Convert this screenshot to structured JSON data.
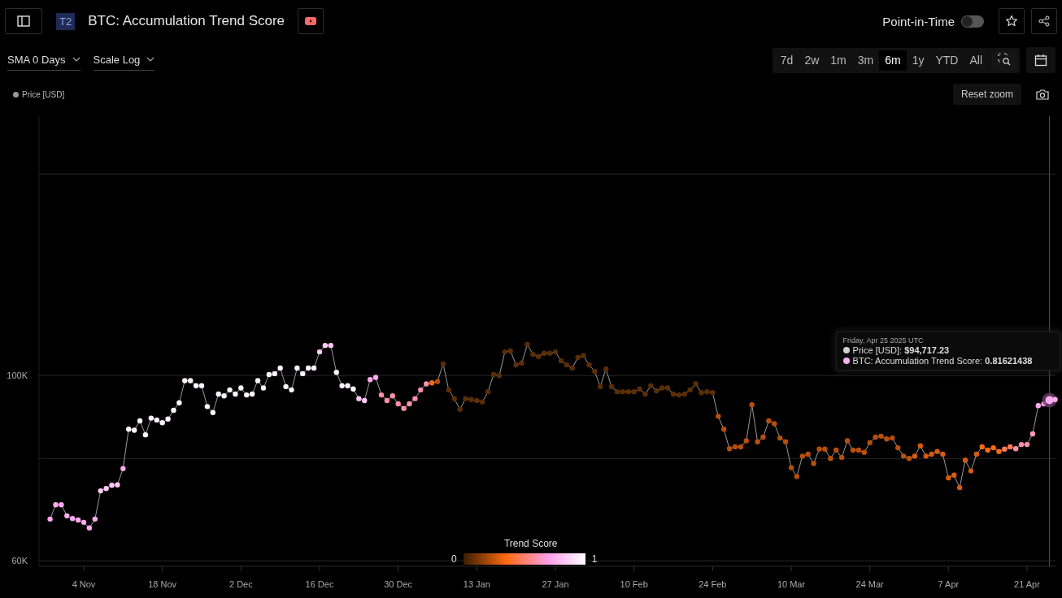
{
  "header": {
    "tier_badge": "T2",
    "title": "BTC: Accumulation Trend Score",
    "point_in_time": {
      "label": "Point-in-Time",
      "on": false
    }
  },
  "controls": {
    "sma": "SMA 0 Days",
    "scale": "Scale Log",
    "ranges": [
      {
        "label": "7d",
        "selected": false
      },
      {
        "label": "2w",
        "selected": false
      },
      {
        "label": "1m",
        "selected": false
      },
      {
        "label": "3m",
        "selected": false
      },
      {
        "label": "6m",
        "selected": true
      },
      {
        "label": "1y",
        "selected": false
      },
      {
        "label": "YTD",
        "selected": false
      },
      {
        "label": "All",
        "selected": false
      }
    ]
  },
  "chart": {
    "reset_zoom": "Reset zoom",
    "tooltip": {
      "date": "Friday, Apr 25 2025 UTC",
      "rows": [
        {
          "text": "Price [USD]: **$94,717.23**",
          "color": "#d0d0d0"
        },
        {
          "text": "BTC: Accumulation Trend Score: **0.81621438**",
          "color": "#f9b0f2"
        }
      ]
    },
    "color_scale": {
      "title": "Trend Score",
      "min_label": "0",
      "max_label": "1"
    },
    "chart_data": {
      "type": "line",
      "ylim": [
        58800,
        156000
      ],
      "categories": [
        null,
        null,
        null,
        null,
        null,
        null,
        "4 Nov",
        null,
        null,
        null,
        null,
        null,
        null,
        null,
        null,
        null,
        null,
        null,
        null,
        null,
        "18 Nov",
        null,
        null,
        null,
        null,
        null,
        null,
        null,
        null,
        null,
        null,
        null,
        null,
        null,
        "2 Dec",
        null,
        null,
        null,
        null,
        null,
        null,
        null,
        null,
        null,
        null,
        null,
        null,
        null,
        "16 Dec",
        null,
        null,
        null,
        null,
        null,
        null,
        null,
        null,
        null,
        null,
        null,
        null,
        null,
        "30 Dec",
        null,
        null,
        null,
        null,
        null,
        null,
        null,
        null,
        null,
        null,
        null,
        null,
        null,
        "13 Jan",
        null,
        null,
        null,
        null,
        null,
        null,
        null,
        null,
        null,
        null,
        null,
        null,
        null,
        "27 Jan",
        null,
        null,
        null,
        null,
        null,
        null,
        null,
        null,
        null,
        null,
        null,
        null,
        null,
        "10 Feb",
        null,
        null,
        null,
        null,
        null,
        null,
        null,
        null,
        null,
        null,
        null,
        null,
        null,
        "24 Feb",
        null,
        null,
        null,
        null,
        null,
        null,
        null,
        null,
        null,
        null,
        null,
        null,
        null,
        "10 Mar",
        null,
        null,
        null,
        null,
        null,
        null,
        null,
        null,
        null,
        null,
        null,
        null,
        null,
        "24 Mar",
        null,
        null,
        null,
        null,
        null,
        null,
        null,
        null,
        null,
        null,
        null,
        null,
        null,
        "7 Apr",
        null,
        null,
        null,
        null,
        null,
        null,
        null,
        null,
        null,
        null,
        null,
        null,
        null,
        "21 Apr",
        null,
        null,
        null,
        null,
        null
      ],
      "series": [
        {
          "name": "Price [USD]",
          "color": "#9a9a9a",
          "marker": "o",
          "values": [
            69000,
            72100,
            72100,
            69700,
            69100,
            68800,
            68300,
            67100,
            69000,
            75100,
            75600,
            76300,
            76400,
            79900,
            88400,
            88200,
            90200,
            87200,
            90800,
            90400,
            89800,
            90600,
            92500,
            94100,
            98900,
            98900,
            97800,
            97800,
            93300,
            92000,
            96000,
            95600,
            96900,
            96000,
            97300,
            95800,
            96000,
            98900,
            97300,
            100200,
            100400,
            101600,
            97600,
            96900,
            101600,
            100400,
            101600,
            101600,
            105100,
            106500,
            106500,
            100700,
            97800,
            97800,
            97100,
            95000,
            94600,
            99100,
            99600,
            95800,
            94600,
            95600,
            93900,
            92900,
            93900,
            95000,
            96900,
            98200,
            98400,
            98700,
            102500,
            96900,
            95000,
            92700,
            95000,
            94800,
            94600,
            94300,
            96500,
            100200,
            100000,
            105100,
            105300,
            102300,
            102700,
            106700,
            104600,
            104100,
            104800,
            104800,
            105100,
            103200,
            102300,
            101600,
            103900,
            104300,
            102300,
            100900,
            97600,
            101400,
            97600,
            96500,
            96500,
            96500,
            96500,
            97100,
            96000,
            97800,
            96700,
            97300,
            97300,
            96000,
            95800,
            96000,
            96900,
            98200,
            96300,
            96500,
            96300,
            91200,
            88400,
            84200,
            84600,
            84600,
            85900,
            93700,
            85700,
            86700,
            90200,
            89600,
            86500,
            85700,
            80100,
            78200,
            82600,
            83000,
            81000,
            84100,
            84100,
            82100,
            83900,
            82300,
            85900,
            83900,
            83900,
            83400,
            85500,
            86700,
            86900,
            86300,
            86500,
            84400,
            82600,
            82100,
            82600,
            84800,
            82600,
            83000,
            83600,
            83000,
            77900,
            78500,
            75800,
            81700,
            79400,
            83000,
            84600,
            83900,
            84400,
            83600,
            84100,
            84600,
            84200,
            85100,
            85100,
            87400,
            93500,
            93900,
            94700,
            94800
          ]
        }
      ],
      "yticks": [
        {
          "value": 60000,
          "label": "60K"
        },
        {
          "value": 100000,
          "label": "100K"
        }
      ]
    },
    "trend_points": [
      {
        "color": "#ffaaee",
        "selected": false
      },
      {
        "color": "#ffaaee",
        "selected": false
      },
      {
        "color": "#ffaaee",
        "selected": false
      },
      {
        "color": "#ffaaee",
        "selected": false
      },
      {
        "color": "#ffaaee",
        "selected": false
      },
      {
        "color": "#ffaaee",
        "selected": false
      },
      {
        "color": "#ffaaee",
        "selected": false
      },
      {
        "color": "#ffaaee",
        "selected": false
      },
      {
        "color": "#ffaaee",
        "selected": false
      },
      {
        "color": "#ffc8f4",
        "selected": false
      },
      {
        "color": "#ffc8f4",
        "selected": false
      },
      {
        "color": "#ffc8f4",
        "selected": false
      },
      {
        "color": "#ffc8f4",
        "selected": false
      },
      {
        "color": "#ffaaee",
        "selected": false
      },
      {
        "color": "#fff4fc",
        "selected": false
      },
      {
        "color": "#fff4fc",
        "selected": false
      },
      {
        "color": "#fff4fc",
        "selected": false
      },
      {
        "color": "#fff4fc",
        "selected": false
      },
      {
        "color": "#fff4fc",
        "selected": false
      },
      {
        "color": "#fff4fc",
        "selected": false
      },
      {
        "color": "#fff4fc",
        "selected": false
      },
      {
        "color": "#fff4fc",
        "selected": false
      },
      {
        "color": "#fff4fc",
        "selected": false
      },
      {
        "color": "#fff4fc",
        "selected": false
      },
      {
        "color": "#fff4fc",
        "selected": false
      },
      {
        "color": "#fff4fc",
        "selected": false
      },
      {
        "color": "#fff4fc",
        "selected": false
      },
      {
        "color": "#fff4fc",
        "selected": false
      },
      {
        "color": "#fff4fc",
        "selected": false
      },
      {
        "color": "#fff4fc",
        "selected": false
      },
      {
        "color": "#fff4fc",
        "selected": false
      },
      {
        "color": "#fff4fc",
        "selected": false
      },
      {
        "color": "#fff4fc",
        "selected": false
      },
      {
        "color": "#fff4fc",
        "selected": false
      },
      {
        "color": "#fff4fc",
        "selected": false
      },
      {
        "color": "#fff4fc",
        "selected": false
      },
      {
        "color": "#fff4fc",
        "selected": false
      },
      {
        "color": "#fff4fc",
        "selected": false
      },
      {
        "color": "#fff4fc",
        "selected": false
      },
      {
        "color": "#fff4fc",
        "selected": false
      },
      {
        "color": "#fff4fc",
        "selected": false
      },
      {
        "color": "#fff4fc",
        "selected": false
      },
      {
        "color": "#fff4fc",
        "selected": false
      },
      {
        "color": "#fff4fc",
        "selected": false
      },
      {
        "color": "#fff4fc",
        "selected": false
      },
      {
        "color": "#fff4fc",
        "selected": false
      },
      {
        "color": "#fff4fc",
        "selected": false
      },
      {
        "color": "#fff4fc",
        "selected": false
      },
      {
        "color": "#ffc8f4",
        "selected": false
      },
      {
        "color": "#ffc8f4",
        "selected": false
      },
      {
        "color": "#ffc8f4",
        "selected": false
      },
      {
        "color": "#fff4fc",
        "selected": false
      },
      {
        "color": "#fff4fc",
        "selected": false
      },
      {
        "color": "#fff4fc",
        "selected": false
      },
      {
        "color": "#fff4fc",
        "selected": false
      },
      {
        "color": "#ffc8f4",
        "selected": false
      },
      {
        "color": "#ffc8f4",
        "selected": false
      },
      {
        "color": "#ffaaee",
        "selected": false
      },
      {
        "color": "#ffaaee",
        "selected": false
      },
      {
        "color": "#ff8fa8",
        "selected": false
      },
      {
        "color": "#ff8fa8",
        "selected": false
      },
      {
        "color": "#ff8fa8",
        "selected": false
      },
      {
        "color": "#ff8fa8",
        "selected": false
      },
      {
        "color": "#ff8fa8",
        "selected": false
      },
      {
        "color": "#ff8fa8",
        "selected": false
      },
      {
        "color": "#ff8fa8",
        "selected": false
      },
      {
        "color": "#ff8fa8",
        "selected": false
      },
      {
        "color": "#ff8fa8",
        "selected": false
      },
      {
        "color": "#ff6a10",
        "selected": false
      },
      {
        "color": "#b84e0c",
        "selected": false
      },
      {
        "color": "#5a2e05",
        "selected": false
      },
      {
        "color": "#5a2e05",
        "selected": false
      },
      {
        "color": "#5a2e05",
        "selected": false
      },
      {
        "color": "#5a2e05",
        "selected": false
      },
      {
        "color": "#5a2e05",
        "selected": false
      },
      {
        "color": "#5a2e05",
        "selected": false
      },
      {
        "color": "#5a2e05",
        "selected": false
      },
      {
        "color": "#5a2e05",
        "selected": false
      },
      {
        "color": "#5a2e05",
        "selected": false
      },
      {
        "color": "#5a2e05",
        "selected": false
      },
      {
        "color": "#5a2e05",
        "selected": false
      },
      {
        "color": "#5a2e05",
        "selected": false
      },
      {
        "color": "#5a2e05",
        "selected": false
      },
      {
        "color": "#5a2e05",
        "selected": false
      },
      {
        "color": "#5a2e05",
        "selected": false
      },
      {
        "color": "#5a2e05",
        "selected": false
      },
      {
        "color": "#5a2e05",
        "selected": false
      },
      {
        "color": "#5a2e05",
        "selected": false
      },
      {
        "color": "#5a2e05",
        "selected": false
      },
      {
        "color": "#5a2e05",
        "selected": false
      },
      {
        "color": "#5a2e05",
        "selected": false
      },
      {
        "color": "#5a2e05",
        "selected": false
      },
      {
        "color": "#5a2e05",
        "selected": false
      },
      {
        "color": "#5a2e05",
        "selected": false
      },
      {
        "color": "#5a2e05",
        "selected": false
      },
      {
        "color": "#5a2e05",
        "selected": false
      },
      {
        "color": "#5a2e05",
        "selected": false
      },
      {
        "color": "#5a2e05",
        "selected": false
      },
      {
        "color": "#5a2e05",
        "selected": false
      },
      {
        "color": "#5a2e05",
        "selected": false
      },
      {
        "color": "#5a2e05",
        "selected": false
      },
      {
        "color": "#5a2e05",
        "selected": false
      },
      {
        "color": "#5a2e05",
        "selected": false
      },
      {
        "color": "#5a2e05",
        "selected": false
      },
      {
        "color": "#5a2e05",
        "selected": false
      },
      {
        "color": "#5a2e05",
        "selected": false
      },
      {
        "color": "#5a2e05",
        "selected": false
      },
      {
        "color": "#5a2e05",
        "selected": false
      },
      {
        "color": "#5a2e05",
        "selected": false
      },
      {
        "color": "#5a2e05",
        "selected": false
      },
      {
        "color": "#5a2e05",
        "selected": false
      },
      {
        "color": "#5a2e05",
        "selected": false
      },
      {
        "color": "#5a2e05",
        "selected": false
      },
      {
        "color": "#5a2e05",
        "selected": false
      },
      {
        "color": "#5a2e05",
        "selected": false
      },
      {
        "color": "#5a2e05",
        "selected": false
      },
      {
        "color": "#5a2e05",
        "selected": false
      },
      {
        "color": "#5a2e05",
        "selected": false
      },
      {
        "color": "#5a2e05",
        "selected": false
      },
      {
        "color": "#b84e0c",
        "selected": false
      },
      {
        "color": "#b84e0c",
        "selected": false
      },
      {
        "color": "#b84e0c",
        "selected": false
      },
      {
        "color": "#b84e0c",
        "selected": false
      },
      {
        "color": "#b84e0c",
        "selected": false
      },
      {
        "color": "#b84e0c",
        "selected": false
      },
      {
        "color": "#b84e0c",
        "selected": false
      },
      {
        "color": "#b84e0c",
        "selected": false
      },
      {
        "color": "#b84e0c",
        "selected": false
      },
      {
        "color": "#b84e0c",
        "selected": false
      },
      {
        "color": "#b84e0c",
        "selected": false
      },
      {
        "color": "#b84e0c",
        "selected": false
      },
      {
        "color": "#b84e0c",
        "selected": false
      },
      {
        "color": "#b84e0c",
        "selected": false
      },
      {
        "color": "#b84e0c",
        "selected": false
      },
      {
        "color": "#b84e0c",
        "selected": false
      },
      {
        "color": "#b84e0c",
        "selected": false
      },
      {
        "color": "#b84e0c",
        "selected": false
      },
      {
        "color": "#b84e0c",
        "selected": false
      },
      {
        "color": "#b84e0c",
        "selected": false
      },
      {
        "color": "#b84e0c",
        "selected": false
      },
      {
        "color": "#b84e0c",
        "selected": false
      },
      {
        "color": "#b84e0c",
        "selected": false
      },
      {
        "color": "#b84e0c",
        "selected": false
      },
      {
        "color": "#b84e0c",
        "selected": false
      },
      {
        "color": "#b84e0c",
        "selected": false
      },
      {
        "color": "#b84e0c",
        "selected": false
      },
      {
        "color": "#b84e0c",
        "selected": false
      },
      {
        "color": "#b84e0c",
        "selected": false
      },
      {
        "color": "#b84e0c",
        "selected": false
      },
      {
        "color": "#b84e0c",
        "selected": false
      },
      {
        "color": "#b84e0c",
        "selected": false
      },
      {
        "color": "#b84e0c",
        "selected": false
      },
      {
        "color": "#b84e0c",
        "selected": false
      },
      {
        "color": "#b84e0c",
        "selected": false
      },
      {
        "color": "#d85a0e",
        "selected": false
      },
      {
        "color": "#d85a0e",
        "selected": false
      },
      {
        "color": "#d85a0e",
        "selected": false
      },
      {
        "color": "#d85a0e",
        "selected": false
      },
      {
        "color": "#d85a0e",
        "selected": false
      },
      {
        "color": "#d85a0e",
        "selected": false
      },
      {
        "color": "#d85a0e",
        "selected": false
      },
      {
        "color": "#d85a0e",
        "selected": false
      },
      {
        "color": "#d85a0e",
        "selected": false
      },
      {
        "color": "#d85a0e",
        "selected": false
      },
      {
        "color": "#d85a0e",
        "selected": false
      },
      {
        "color": "#d85a0e",
        "selected": false
      },
      {
        "color": "#ff6a10",
        "selected": false
      },
      {
        "color": "#ff6a10",
        "selected": false
      },
      {
        "color": "#ff6a10",
        "selected": false
      },
      {
        "color": "#ff6a10",
        "selected": false
      },
      {
        "color": "#ff7a50",
        "selected": false
      },
      {
        "color": "#ff7a50",
        "selected": false
      },
      {
        "color": "#ff8fa8",
        "selected": false
      },
      {
        "color": "#ff8fa8",
        "selected": false
      },
      {
        "color": "#ff8fa8",
        "selected": false
      },
      {
        "color": "#ff9ab8",
        "selected": false
      },
      {
        "color": "#ffaaee",
        "selected": false
      },
      {
        "color": "#ffaaee",
        "selected": false
      },
      {
        "color": "#ffaaee",
        "selected": true
      },
      {
        "color": "#ffaaee",
        "selected": false
      }
    ]
  }
}
